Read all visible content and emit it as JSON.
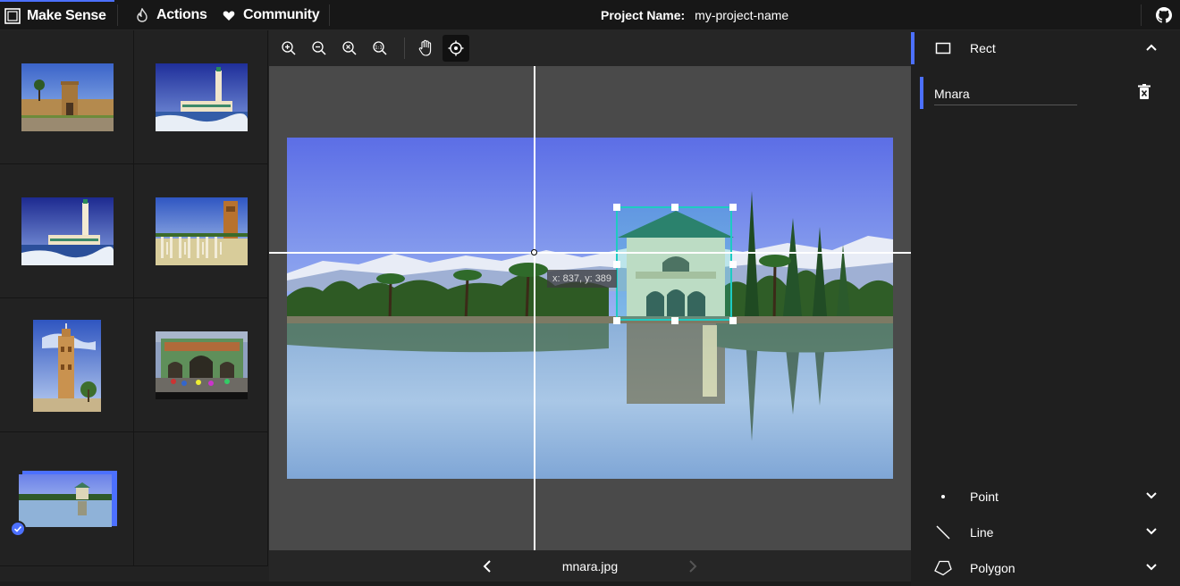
{
  "app": {
    "brand": "Make Sense",
    "nav": [
      {
        "label": "Actions",
        "icon": "fire-icon"
      },
      {
        "label": "Community",
        "icon": "heart-icon"
      }
    ],
    "project_label": "Project Name:",
    "project_name": "my-project-name",
    "github_icon": "github-icon"
  },
  "colors": {
    "accent": "#4c70ff",
    "bbox": "#1ecbc2",
    "topbar_bg": "#171717",
    "panel_bg": "#222222",
    "canvas_bg": "#4a4a4a"
  },
  "toolbar": {
    "tools": [
      "zoom-in-icon",
      "zoom-out-icon",
      "zoom-fit-icon",
      "zoom-reset-icon",
      "hand-icon",
      "crosshair-icon"
    ],
    "active_tool": "crosshair-icon"
  },
  "gallery": {
    "images": [
      {
        "scene": "kasbah"
      },
      {
        "scene": "mosque"
      },
      {
        "scene": "mosque-night"
      },
      {
        "scene": "columns"
      },
      {
        "scene": "minaret"
      },
      {
        "scene": "gate"
      },
      {
        "scene": "menara",
        "active": true,
        "checked": true
      }
    ]
  },
  "editor": {
    "cursor_readout": "x: 837, y: 389",
    "filename": "mnara.jpg",
    "prev_icon": "chevron-left-icon",
    "next_icon": "chevron-right-icon"
  },
  "label_panel": {
    "rect": {
      "title": "Rect",
      "expanded": true,
      "labels": [
        {
          "name": "Mnara"
        }
      ]
    },
    "point": {
      "title": "Point"
    },
    "line": {
      "title": "Line"
    },
    "polygon": {
      "title": "Polygon"
    }
  }
}
